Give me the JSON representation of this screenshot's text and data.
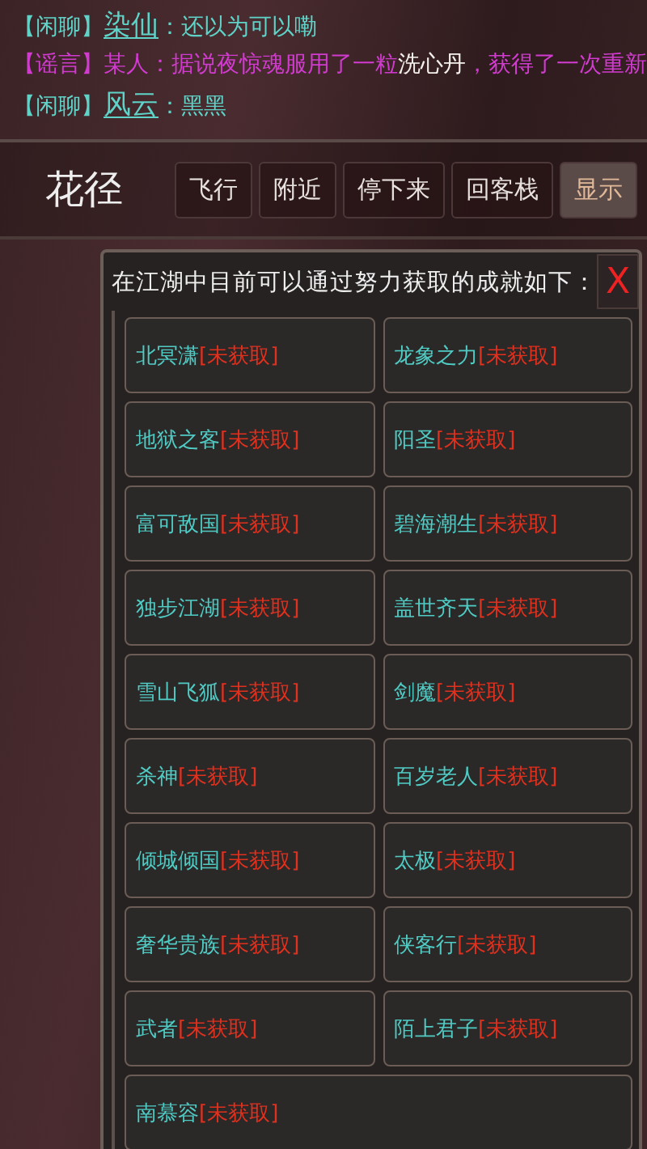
{
  "chat": [
    {
      "kind": "chat",
      "channel": "【闲聊】",
      "speaker": "染仙",
      "segments": [
        {
          "text": "：还以为可以嘞",
          "highlight": false
        }
      ]
    },
    {
      "kind": "rumor",
      "channel": "【谣言】",
      "speaker": "某人：",
      "segments": [
        {
          "text": "据说夜惊魂服用了一粒",
          "highlight": false
        },
        {
          "text": "洗心丹",
          "highlight": true
        },
        {
          "text": "，获得了一次重新",
          "highlight": false
        }
      ]
    },
    {
      "kind": "chat",
      "channel": "【闲聊】",
      "speaker": "风云",
      "segments": [
        {
          "text": "：黑黑",
          "highlight": false
        }
      ]
    }
  ],
  "location": "花径",
  "actions": [
    {
      "label": "飞行",
      "selected": false
    },
    {
      "label": "附近",
      "selected": false
    },
    {
      "label": "停下来",
      "selected": false
    },
    {
      "label": "回客栈",
      "selected": false
    },
    {
      "label": "显示",
      "selected": true
    }
  ],
  "panel": {
    "title": "在江湖中目前可以通过努力获取的成就如下：",
    "close": "X",
    "achievements": [
      {
        "name": "北冥潇",
        "status": "[未获取]",
        "obtained": false
      },
      {
        "name": "龙象之力",
        "status": "[未获取]",
        "obtained": false
      },
      {
        "name": "地狱之客",
        "status": "[未获取]",
        "obtained": false
      },
      {
        "name": "阳圣",
        "status": "[未获取]",
        "obtained": false
      },
      {
        "name": "富可敌国",
        "status": "[未获取]",
        "obtained": false
      },
      {
        "name": "碧海潮生",
        "status": "[未获取]",
        "obtained": false
      },
      {
        "name": "独步江湖",
        "status": "[未获取]",
        "obtained": false
      },
      {
        "name": "盖世齐天",
        "status": "[未获取]",
        "obtained": false
      },
      {
        "name": "雪山飞狐",
        "status": "[未获取]",
        "obtained": false
      },
      {
        "name": "剑魔",
        "status": "[未获取]",
        "obtained": false
      },
      {
        "name": "杀神",
        "status": "[未获取]",
        "obtained": false
      },
      {
        "name": "百岁老人",
        "status": "[未获取]",
        "obtained": false
      },
      {
        "name": "倾城倾国",
        "status": "[未获取]",
        "obtained": false
      },
      {
        "name": "太极",
        "status": "[未获取]",
        "obtained": false
      },
      {
        "name": "奢华贵族",
        "status": "[未获取]",
        "obtained": false
      },
      {
        "name": "侠客行",
        "status": "[未获取]",
        "obtained": false
      },
      {
        "name": "武者",
        "status": "[未获取]",
        "obtained": false
      },
      {
        "name": "陌上君子",
        "status": "[未获取]",
        "obtained": false
      },
      {
        "name": "南慕容",
        "status": "[未获取]",
        "obtained": false
      }
    ]
  }
}
